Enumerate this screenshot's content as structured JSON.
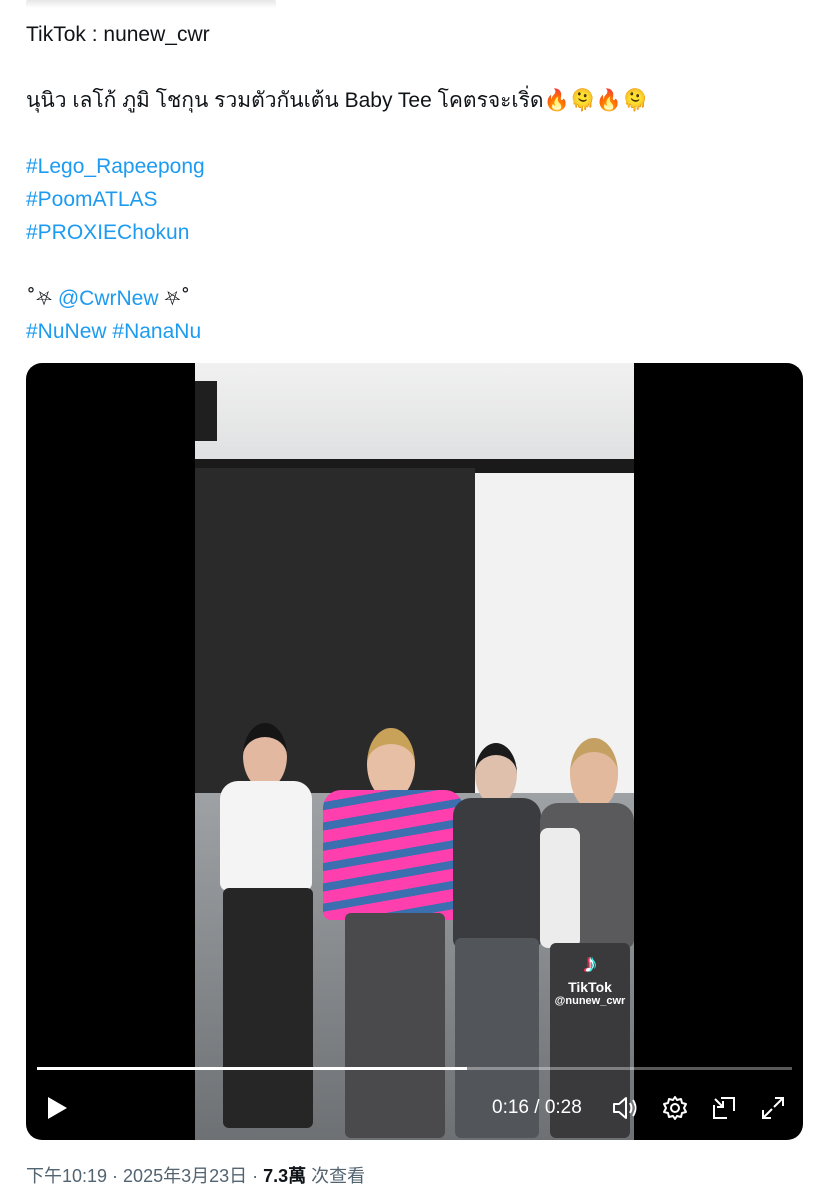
{
  "tweet": {
    "line1": "TikTok : nunew_cwr",
    "line2": "นุนิว เลโก้ ภูมิ โชกุน รวมตัวกันเต้น Baby Tee โคตรจะเริ่ด",
    "emojis": [
      "🔥",
      "🫠",
      "🔥",
      "🫠"
    ],
    "hashtags1": [
      "#Lego_Rapeepong",
      "#PoomATLAS",
      "#PROXIEChokun"
    ],
    "deco_left": "˚⛧",
    "mention": "@CwrNew",
    "deco_right": "⛧˚",
    "hashtags2": [
      "#NuNew",
      "#NanaNu"
    ]
  },
  "video": {
    "watermark_brand": "TikTok",
    "watermark_handle": "@nunew_cwr",
    "progress_fraction": 0.57,
    "current_time": "0:16",
    "duration": "0:28",
    "time_separator": " / ",
    "icons": [
      "play-icon",
      "volume-icon",
      "settings-icon",
      "picture-in-picture-icon",
      "fullscreen-icon"
    ]
  },
  "meta": {
    "time": "下午10:19",
    "sep1": " · ",
    "date": "2025年3月23日",
    "sep2": " · ",
    "views": "7.3萬",
    "views_label": " 次查看"
  }
}
